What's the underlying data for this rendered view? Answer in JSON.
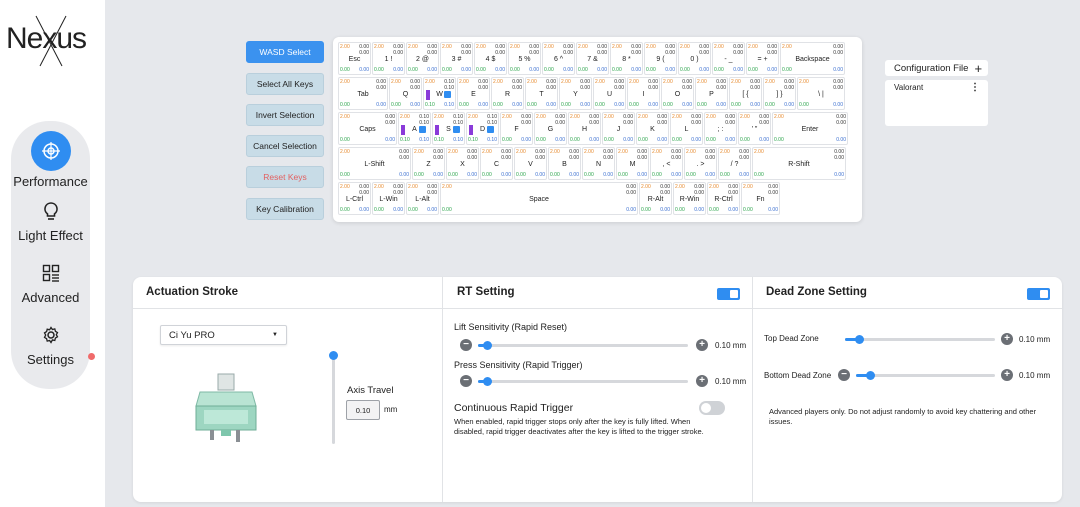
{
  "app": {
    "logo_text": "Nexus"
  },
  "sidebar": {
    "items": [
      {
        "label": "Performance",
        "icon": "crosshair-icon",
        "active": true
      },
      {
        "label": "Light Effect",
        "icon": "lightbulb-icon"
      },
      {
        "label": "Advanced",
        "icon": "grid-icon"
      },
      {
        "label": "Settings",
        "icon": "gear-icon"
      }
    ]
  },
  "actions": {
    "wasd_select": "WASD Select",
    "select_all": "Select All Keys",
    "invert": "Invert Selection",
    "cancel": "Cancel Selection",
    "reset": "Reset Keys",
    "calibration": "Key Calibration"
  },
  "keyboard": {
    "rows": [
      [
        "Esc",
        "1 !",
        "2 @",
        "3 #",
        "4 $",
        "5 %",
        "6 ^",
        "7 &",
        "8 *",
        "9 (",
        "0 )",
        "- _",
        "= +",
        "Backspace"
      ],
      [
        "Tab",
        "Q",
        "W",
        "E",
        "R",
        "T",
        "Y",
        "U",
        "I",
        "O",
        "P",
        "[ {",
        "] }",
        "\\ |"
      ],
      [
        "Caps",
        "A",
        "S",
        "D",
        "F",
        "G",
        "H",
        "J",
        "K",
        "L",
        "; :",
        "' \"",
        "Enter"
      ],
      [
        "L-Shift",
        "Z",
        "X",
        "C",
        "V",
        "B",
        "N",
        "M",
        ", <",
        ". >",
        "/ ?",
        "R-Shift"
      ],
      [
        "L-Ctrl",
        "L-Win",
        "L-Alt",
        "Space",
        "R-Alt",
        "R-Win",
        "R-Ctrl",
        "Fn"
      ]
    ],
    "default_top": "2.00",
    "default_right": "0.00",
    "selected_right": "0.10",
    "default_bottom_left": "0.00",
    "default_bottom_right": "0.00",
    "selected_bottom": "0.10"
  },
  "config": {
    "title": "Configuration File",
    "items": [
      "Valorant"
    ]
  },
  "actuation": {
    "title": "Actuation Stroke",
    "switch": "Ci Yu PRO",
    "axis_label": "Axis Travel",
    "axis_value": "0.10",
    "unit": "mm"
  },
  "rt": {
    "title": "RT Setting",
    "lift_label": "Lift Sensitivity (Rapid Reset)",
    "lift_value": "0.10 mm",
    "press_label": "Press Sensitivity (Rapid Trigger)",
    "press_value": "0.10 mm",
    "crt_label": "Continuous Rapid Trigger",
    "crt_desc": "When enabled, rapid trigger stops only after the key is fully lifted. When disabled, rapid trigger deactivates after the key is lifted to the trigger stroke."
  },
  "deadzone": {
    "title": "Dead Zone Setting",
    "top_label": "Top Dead Zone",
    "top_value": "0.10 mm",
    "bottom_label": "Bottom Dead Zone",
    "bottom_value": "0.10 mm",
    "note": "Advanced players only. Do not adjust randomly to avoid key chattering and other issues."
  },
  "colors": {
    "accent": "#2f8df1",
    "reset": "#e36060"
  }
}
